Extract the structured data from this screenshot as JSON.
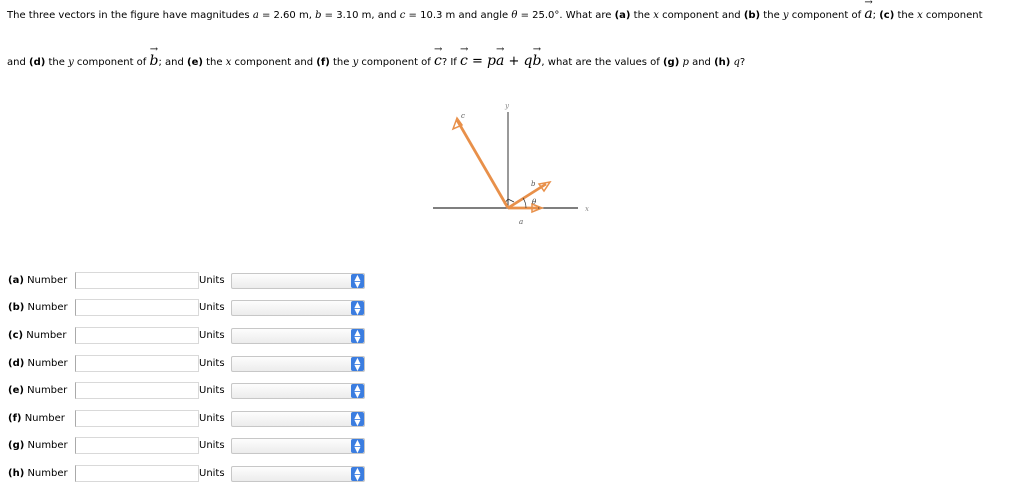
{
  "question": {
    "line1": {
      "t1": "The three vectors in the figure have magnitudes ",
      "a_sym": "a",
      "t2": " = 2.60 m, ",
      "b_sym": "b",
      "t3": " = 3.10 m, and ",
      "c_sym": "c",
      "t4": " = 10.3 m and angle ",
      "theta_sym": "θ",
      "t5": " = 25.0°. What are ",
      "pa": "(a)",
      "t6": " the ",
      "x1": "x",
      "t7": " component and ",
      "pb": "(b)",
      "t8": " the ",
      "y1": "y",
      "t9": " component of ",
      "vec_a": "a",
      "t10": "; ",
      "pc": "(c)",
      "t11": " the ",
      "x2": "x",
      "t12": " component"
    },
    "line2": {
      "t1": "and ",
      "pd": "(d)",
      "t2": " the ",
      "y1": "y",
      "t3": " component of ",
      "vec_b": "b",
      "t4": "; and ",
      "pe": "(e)",
      "t5": " the ",
      "x1": "x",
      "t6": " component and ",
      "pf": "(f)",
      "t7": " the ",
      "y2": "y",
      "t8": " component of ",
      "vec_c": "c",
      "t9": "? If ",
      "eq_c": "c",
      "eq1": " = ",
      "eq_p": "p",
      "eq_a": "a",
      "eq2": " + ",
      "eq_q": "q",
      "eq_b": "b",
      "t10": ", what are the values of ",
      "pg": "(g)",
      "t11": " ",
      "p": "p",
      "t12": " and ",
      "ph": "(h)",
      "t13": " ",
      "q": "q",
      "t14": "?"
    },
    "arrow_glyph": "→"
  },
  "figure": {
    "y_axis": "y",
    "x_axis": "x",
    "c_label": "c",
    "b_label": "b",
    "a_label": "a",
    "theta_label": "θ",
    "vector_color": "#e8904a"
  },
  "answers": [
    {
      "part": "(a)",
      "label": "Number",
      "units_label": "Units",
      "value": "",
      "units": ""
    },
    {
      "part": "(b)",
      "label": "Number",
      "units_label": "Units",
      "value": "",
      "units": ""
    },
    {
      "part": "(c)",
      "label": "Number",
      "units_label": "Units",
      "value": "",
      "units": ""
    },
    {
      "part": "(d)",
      "label": "Number",
      "units_label": "Units",
      "value": "",
      "units": ""
    },
    {
      "part": "(e)",
      "label": "Number",
      "units_label": "Units",
      "value": "",
      "units": ""
    },
    {
      "part": "(f)",
      "label": "Number",
      "units_label": "Units",
      "value": "",
      "units": ""
    },
    {
      "part": "(g)",
      "label": "Number",
      "units_label": "Units",
      "value": "",
      "units": ""
    },
    {
      "part": "(h)",
      "label": "Number",
      "units_label": "Units",
      "value": "",
      "units": ""
    }
  ],
  "select_icon": "chevron-updown-icon"
}
